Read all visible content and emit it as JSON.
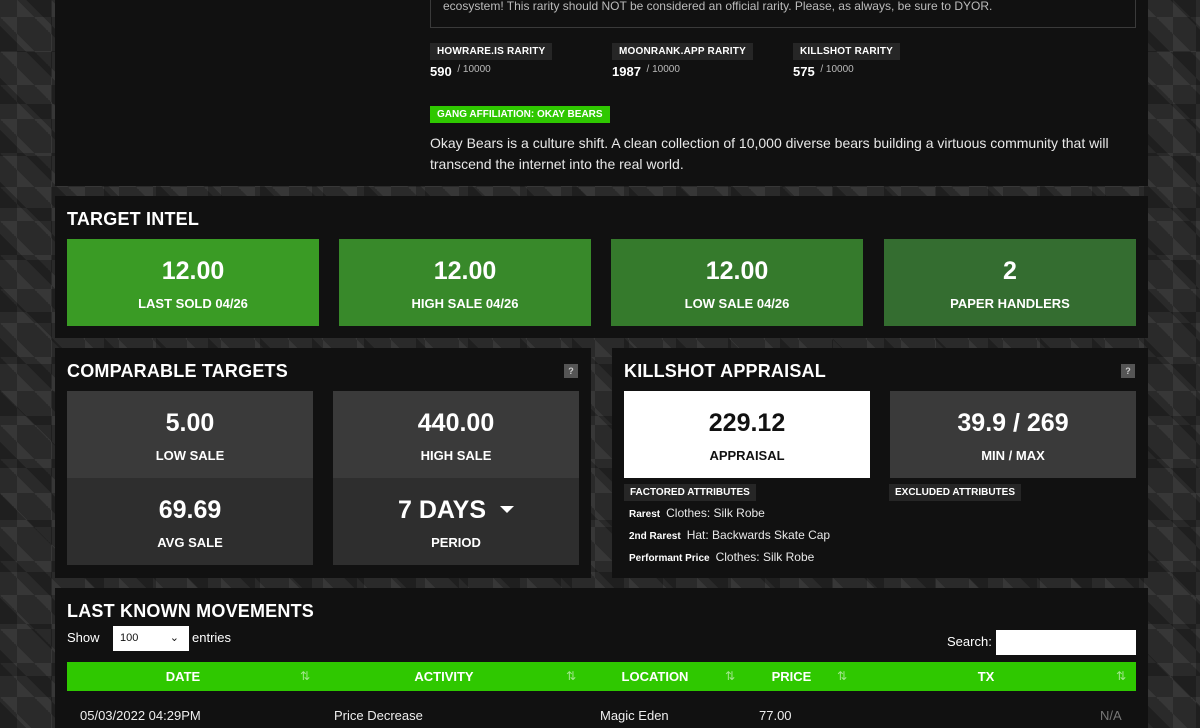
{
  "top": {
    "notice": "ecosystem! This rarity should NOT be considered an official rarity. Please, as always, be sure to DYOR.",
    "rarities": [
      {
        "label": "HOWRARE.IS RARITY",
        "value": "590",
        "out_of": "/ 10000"
      },
      {
        "label": "MOONRANK.APP RARITY",
        "value": "1987",
        "out_of": "/ 10000"
      },
      {
        "label": "KILLSHOT RARITY",
        "value": "575",
        "out_of": "/ 10000"
      }
    ],
    "gang": "GANG AFFILIATION: OKAY BEARS",
    "description": "Okay Bears is a culture shift. A clean collection of 10,000 diverse bears building a virtuous community that will transcend the internet into the real world."
  },
  "intel": {
    "title": "TARGET INTEL",
    "cards": [
      {
        "value": "12.00",
        "label": "LAST SOLD 04/26",
        "color": "#3a9b25"
      },
      {
        "value": "12.00",
        "label": "HIGH SALE 04/26",
        "color": "#38892a"
      },
      {
        "value": "12.00",
        "label": "LOW SALE 04/26",
        "color": "#357a2c"
      },
      {
        "value": "2",
        "label": "PAPER HANDLERS",
        "color": "#346d30"
      }
    ]
  },
  "comparable": {
    "title": "COMPARABLE TARGETS",
    "help": "?",
    "low": {
      "value": "5.00",
      "label": "LOW SALE"
    },
    "high": {
      "value": "440.00",
      "label": "HIGH SALE"
    },
    "avg": {
      "value": "69.69",
      "label": "AVG SALE"
    },
    "period": {
      "value": "7 DAYS",
      "label": "PERIOD"
    }
  },
  "appraisal": {
    "title": "KILLSHOT APPRAISAL",
    "help": "?",
    "appraisal": {
      "value": "229.12",
      "label": "APPRAISAL"
    },
    "minmax": {
      "value": "39.9 / 269",
      "label": "MIN / MAX"
    },
    "factored_label": "FACTORED ATTRIBUTES",
    "excluded_label": "EXCLUDED ATTRIBUTES",
    "factored": [
      {
        "key": "Rarest",
        "value": "Clothes: Silk Robe"
      },
      {
        "key": "2nd Rarest",
        "value": "Hat: Backwards Skate Cap"
      },
      {
        "key": "Performant Price",
        "value": "Clothes: Silk Robe"
      }
    ]
  },
  "movements": {
    "title": "LAST KNOWN MOVEMENTS",
    "show_label": "Show",
    "show_value": "100",
    "entries_label": "entries",
    "search_label": "Search:",
    "columns": [
      "DATE",
      "ACTIVITY",
      "LOCATION",
      "PRICE",
      "TX"
    ],
    "rows": [
      {
        "date": "05/03/2022 04:29PM",
        "activity": "Price Decrease",
        "location": "Magic Eden",
        "price": "77.00",
        "tx": "N/A"
      }
    ]
  }
}
